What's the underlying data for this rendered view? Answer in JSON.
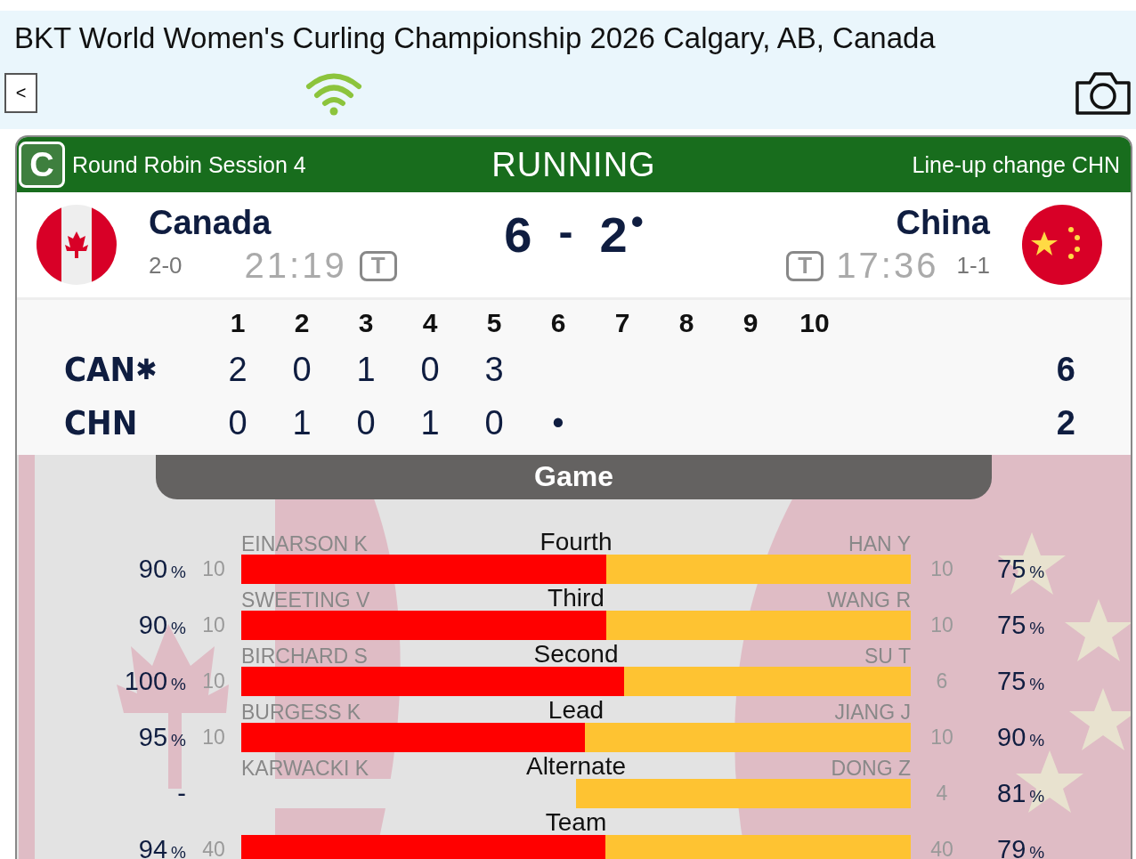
{
  "header": {
    "title": "BKT World Women's Curling Championship 2026 Calgary, AB, Canada",
    "back_label": "<"
  },
  "game": {
    "badge": "C",
    "session": "Round Robin Session 4",
    "status": "RUNNING",
    "notice": "Line-up change CHN"
  },
  "home": {
    "name": "Canada",
    "record": "2-0",
    "clock": "21:19",
    "timeout_label": "T",
    "score": "6",
    "flag": {
      "kind": "canada"
    }
  },
  "away": {
    "name": "China",
    "record": "1-1",
    "clock": "17:36",
    "timeout_label": "T",
    "score": "2",
    "hammer": "•",
    "flag": {
      "kind": "china"
    }
  },
  "score_separator": "-",
  "linescore": {
    "ends": [
      "1",
      "2",
      "3",
      "4",
      "5",
      "6",
      "7",
      "8",
      "9",
      "10"
    ],
    "teams": [
      {
        "code": "CAN",
        "marker": "✱",
        "scores": [
          "2",
          "0",
          "1",
          "0",
          "3"
        ],
        "total": "6"
      },
      {
        "code": "CHN",
        "scores": [
          "0",
          "1",
          "0",
          "1",
          "0",
          "•"
        ],
        "total": "2"
      }
    ]
  },
  "tab": {
    "label": "Game"
  },
  "stats": [
    {
      "position": "Fourth",
      "home_name": "EINARSON K",
      "away_name": "HAN Y",
      "home_pct": "90",
      "home_shots": "10",
      "away_shots": "10",
      "away_pct": "75",
      "pct_sign": "%",
      "home_bar": {
        "level": 0.545
      },
      "away_bar": {
        "level": 0.455
      }
    },
    {
      "position": "Third",
      "home_name": "SWEETING V",
      "away_name": "WANG R",
      "home_pct": "90",
      "home_shots": "10",
      "away_shots": "10",
      "away_pct": "75",
      "pct_sign": "%",
      "home_bar": {
        "level": 0.545
      },
      "away_bar": {
        "level": 0.455
      }
    },
    {
      "position": "Second",
      "home_name": "BIRCHARD S",
      "away_name": "SU T",
      "home_pct": "100",
      "home_shots": "10",
      "away_shots": "6",
      "away_pct": "75",
      "pct_sign": "%",
      "home_bar": {
        "level": 0.572
      },
      "away_bar": {
        "level": 0.428
      }
    },
    {
      "position": "Lead",
      "home_name": "BURGESS K",
      "away_name": "JIANG J",
      "home_pct": "95",
      "home_shots": "10",
      "away_shots": "10",
      "away_pct": "90",
      "pct_sign": "%",
      "home_bar": {
        "level": 0.513
      },
      "away_bar": {
        "level": 0.487
      }
    },
    {
      "position": "Alternate",
      "home_name": "KARWACKI K",
      "away_name": "DONG Z",
      "home_pct": "-",
      "away_shots": "4",
      "away_pct": "81",
      "pct_sign": "%",
      "away_bar": {
        "level": 0.5
      }
    },
    {
      "position": "Team",
      "home_pct": "94",
      "home_shots": "40",
      "away_shots": "40",
      "away_pct": "79",
      "pct_sign": "%",
      "home_bar": {
        "level": 0.544
      },
      "away_bar": {
        "level": 0.456
      }
    }
  ]
}
